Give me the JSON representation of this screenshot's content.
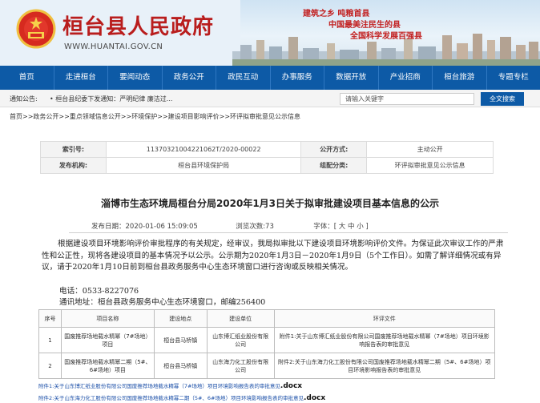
{
  "header": {
    "site_title": "桓台县人民政府",
    "site_url": "WWW.HUANTAI.GOV.CN",
    "slogans": [
      "建筑之乡 吨粮首县",
      "中国最美注民生的县",
      "全国科学发展百强县"
    ]
  },
  "nav": {
    "items": [
      "首页",
      "走进桓台",
      "要闻动态",
      "政务公开",
      "政民互动",
      "办事服务",
      "数据开放",
      "产业招商",
      "桓台旅游",
      "专题专栏"
    ]
  },
  "notice": {
    "label": "通知公告:",
    "text": "• 桓台县纪委下发通知：严明纪律 廉洁过..."
  },
  "search": {
    "placeholder": "请输入关键字",
    "button": "全文搜索"
  },
  "breadcrumb": "首页>>政务公开>>重点领域信息公开>>环境保护>>建设项目影响评价>>环评拟审批意见公示信息",
  "info": {
    "index_label": "索引号:",
    "index_value": "11370321004221062T/2020-00022",
    "scope_label": "公开方式:",
    "scope_value": "主动公开",
    "publisher_label": "发布机构:",
    "publisher_value": "桓台县环境保护局",
    "category_label": "组配分类:",
    "category_value": "环评拟审批意见公示信息"
  },
  "document": {
    "title": "淄博市生态环境局桓台分局2020年1月3日关于拟审批建设项目基本信息的公示",
    "date": "发布日期：2020-01-06 15:09:05",
    "views": "浏览次数:73",
    "font_size": "字体：[ 大 中 小 ]",
    "paragraph": "根据建设项目环境影响评价审批程序的有关规定，经审议，我局拟审批以下建设项目环境影响评价文件。为保证此次审议工作的严肃性和公正性，现将各建设项目的基本情况予以公示。公示期为2020年1月3日－2020年1月9日（5个工作日）。如需了解详细情况或有异议，请于2020年1月10日前到桓台县政务服务中心生态环境窗口进行咨询或反映相关情况。",
    "phone": "电话：0533-8227076",
    "address": "通讯地址：桓台县政务服务中心生态环境窗口，邮编256400"
  },
  "table": {
    "headers": [
      "序号",
      "项目名称",
      "建设地点",
      "建设单位",
      "环评文件"
    ],
    "rows": [
      [
        "1",
        "国废推荐场地载水精幂（7#场地）项目",
        "桓台县马桥镇",
        "山东博汇纸业股份有限公司",
        "附件1:关于山东博汇纸业股份有限公司国废推荐场地载水精幂（7#场地）项目环境影响报告表的审批意见"
      ],
      [
        "2",
        "国废推荐场地载水精幂二期（5#、6#场地）项目",
        "桓台县马桥镇",
        "山东海力化工股份有限公司",
        "附件2:关于山东海力化工股份有限公司国废推荐场地载水精幂二期（5#、6#场地）项目环境影响报告表的审批意见"
      ]
    ]
  },
  "attachments": [
    {
      "text": "附件1:关于山东博汇纸业股份有限公司国废推荐场地载水精幂（7#场地）项目环境影响报告表的审批意见",
      "ext": ".docx"
    },
    {
      "text": "附件2:关于山东海力化工股份有限公司国废推荐场地载水精幂二期（5#、6#场地）项目环境影响报告表的审批意见",
      "ext": ".docx"
    }
  ],
  "colors": {
    "brand_red": "#b91d1d",
    "nav_blue": "#0d5aa6",
    "link_blue": "#1b4fa8"
  }
}
